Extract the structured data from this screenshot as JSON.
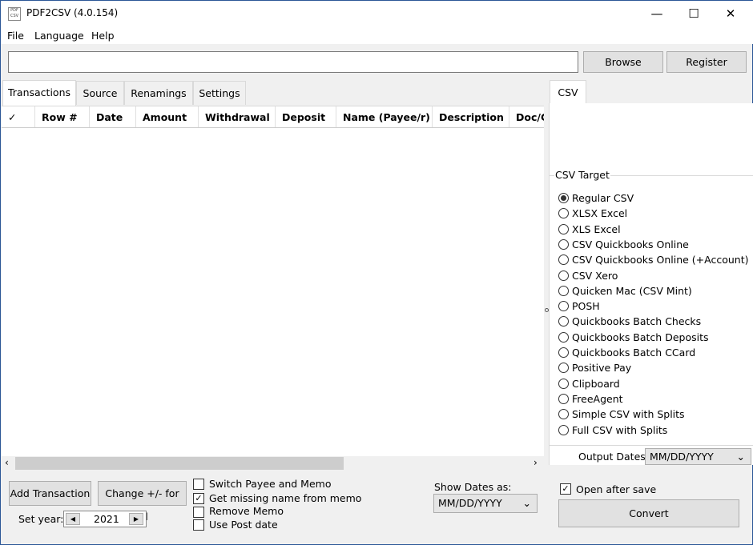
{
  "window": {
    "title": "PDF2CSV (4.0.154)",
    "icon_text": "PDF CSV"
  },
  "menu": [
    "File",
    "Language",
    "Help"
  ],
  "path": {
    "value": ""
  },
  "buttons": {
    "browse": "Browse",
    "register": "Register",
    "add_transaction": "Add Transaction",
    "change_sign": "Change +/- for all",
    "convert": "Convert"
  },
  "tabs": [
    "Transactions",
    "Source",
    "Renamings",
    "Settings"
  ],
  "columns": [
    "✓",
    "Row #",
    "Date",
    "Amount",
    "Withdrawal",
    "Deposit",
    "Name (Payee/r)",
    "Description",
    "Doc/C"
  ],
  "options": [
    {
      "label": "Switch Payee and Memo",
      "checked": false
    },
    {
      "label": "Get missing name from memo",
      "checked": true
    },
    {
      "label": "Remove Memo",
      "checked": false
    },
    {
      "label": "Use Post date",
      "checked": false
    }
  ],
  "year": {
    "label": "Set year:",
    "value": "2021"
  },
  "show_dates": {
    "label": "Show Dates as:",
    "value": "MM/DD/YYYY"
  },
  "right": {
    "tab": "CSV",
    "group": "CSV Target",
    "targets": [
      "Regular CSV",
      "XLSX Excel",
      "XLS Excel",
      "CSV Quickbooks Online",
      "CSV Quickbooks Online (+Account)",
      "CSV Xero",
      "Quicken Mac (CSV Mint)",
      "POSH",
      "Quickbooks Batch Checks",
      "Quickbooks Batch Deposits",
      "Quickbooks Batch CCard",
      "Positive Pay",
      "Clipboard",
      "FreeAgent",
      "Simple CSV with Splits",
      "Full CSV with Splits"
    ],
    "selected": "Regular CSV",
    "output_dates_label": "Output Dates:",
    "output_dates": "MM/DD/YYYY",
    "open_after_save": {
      "label": "Open after save",
      "checked": true
    }
  }
}
